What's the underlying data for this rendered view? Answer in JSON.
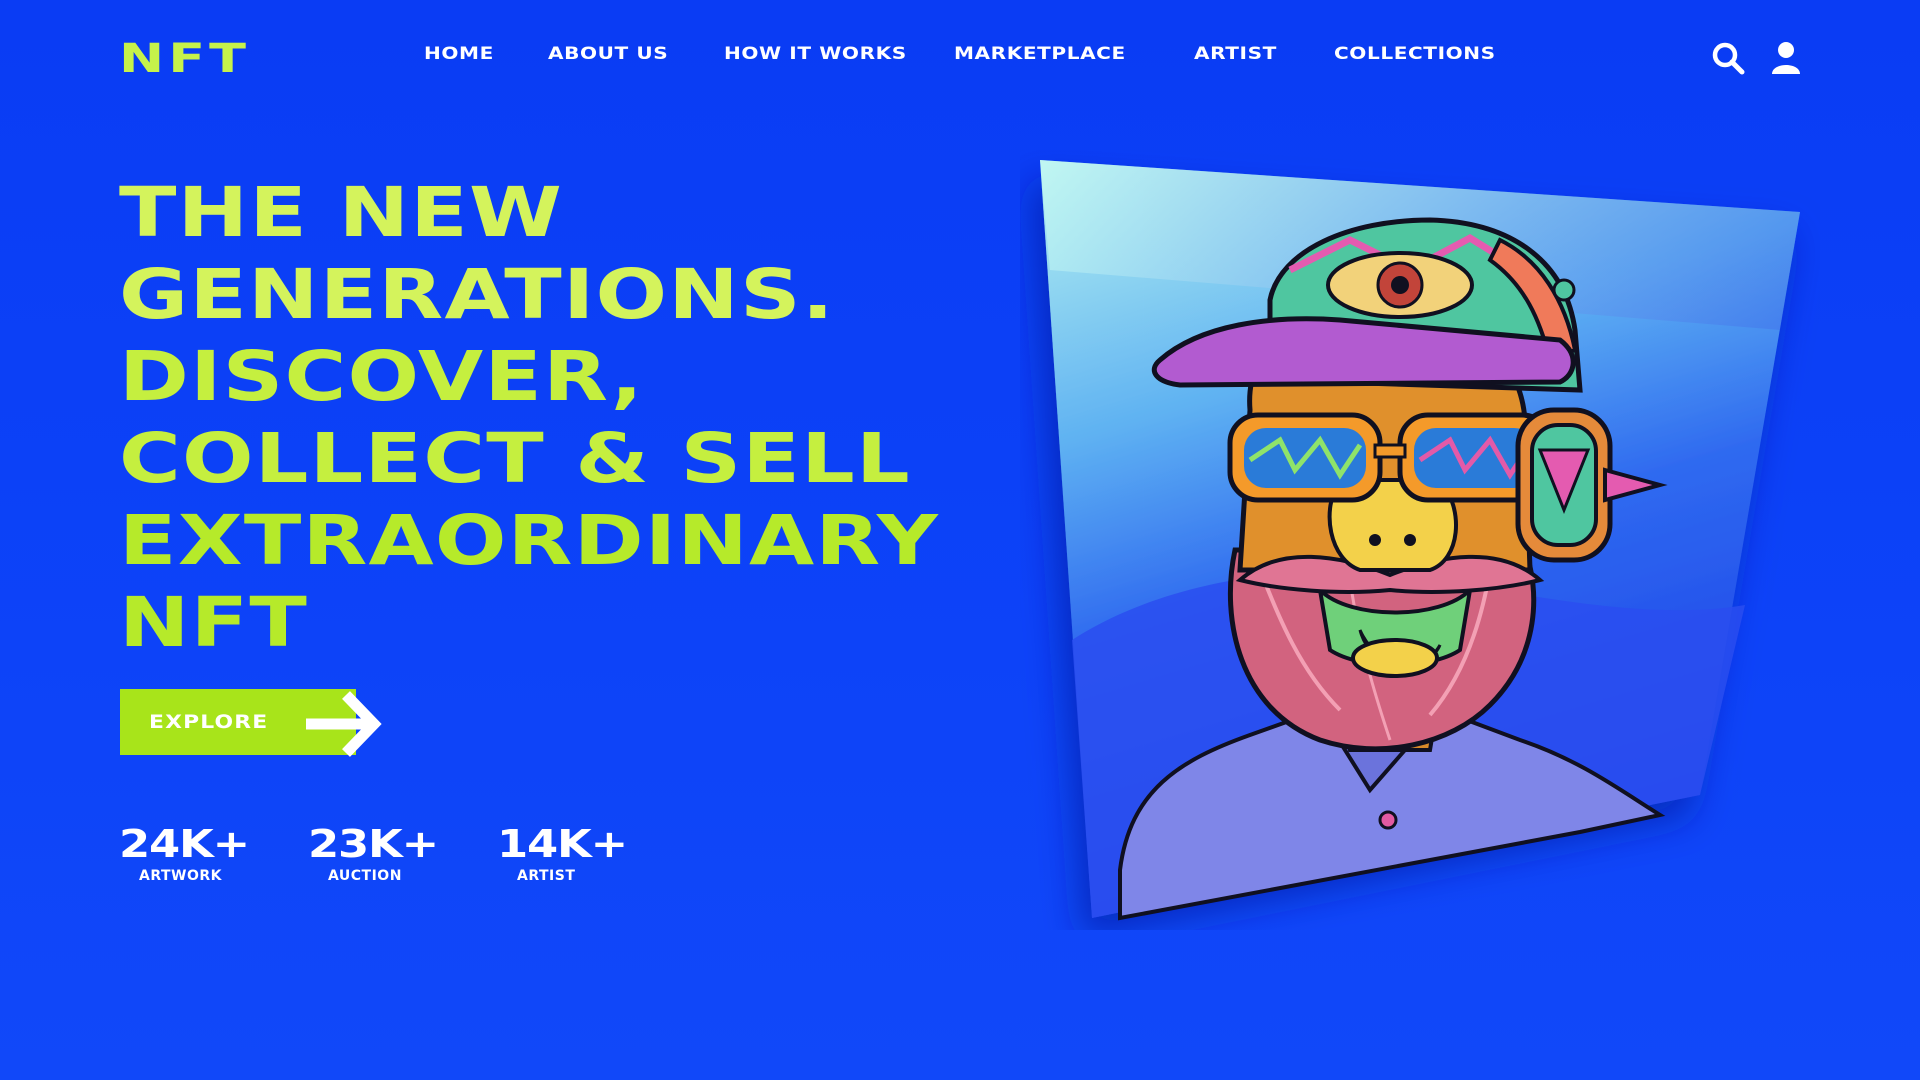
{
  "nav": {
    "logo": "NFT",
    "items": [
      {
        "label": "HOME"
      },
      {
        "label": "ABOUT US"
      },
      {
        "label": "HOW IT WORKS"
      },
      {
        "label": "MARKETPLACE"
      },
      {
        "label": "ARTIST"
      },
      {
        "label": "COLLECTIONS"
      }
    ],
    "icons": [
      "search-icon",
      "user-icon"
    ]
  },
  "hero": {
    "title_lines": [
      "THE NEW",
      "GENERATIONS.",
      "DISCOVER,",
      "COLLECT & SELL",
      "EXTRAORDINARY",
      "NFT"
    ],
    "cta_label": "EXPLORE"
  },
  "stats": [
    {
      "value": "24K+",
      "label": "ARTWORK"
    },
    {
      "value": "23K+",
      "label": "AUCTION"
    },
    {
      "value": "14K+",
      "label": "ARTIST"
    }
  ],
  "colors": {
    "background": "#0a3cf4",
    "accent": "#a8e41a",
    "title": "#c5ef3f",
    "text": "#ffffff"
  },
  "artwork": {
    "subject": "bearded-character-illustration"
  }
}
